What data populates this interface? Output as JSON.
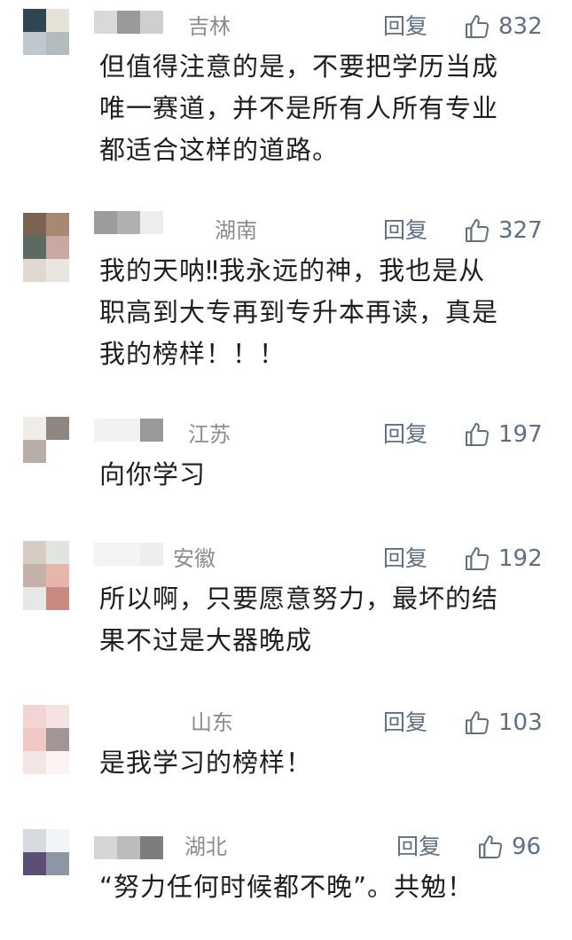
{
  "reply_label": "回复",
  "comments": [
    {
      "region": "吉林",
      "likes": "832",
      "text": "但值得注意的是，不要把学历当成\n唯一赛道，并不是所有人所有专业\n都适合这样的道路。",
      "avatar_colors": [
        "#2f4552",
        "#e6e3d6",
        "#bfc8cc",
        "#b4bbbe"
      ],
      "name_colors": [
        "#d9d9d9",
        "#9a9a9a",
        "#cfcfcf"
      ]
    },
    {
      "region": "湖南",
      "likes": "327",
      "text": "我的天呐‼我永远的神，我也是从\n职高到大专再到专升本再读，真是\n我的榜样！！！",
      "avatar_colors": [
        "#7a6350",
        "#a88870",
        "#5c6b62",
        "#c8a8a0",
        "#e0d9cf",
        "#e8e6df"
      ],
      "name_colors": [
        "#9c9c9c",
        "#b0b0b0",
        "#ededed"
      ]
    },
    {
      "region": "江苏",
      "likes": "197",
      "text": "向你学习",
      "avatar_colors": [
        "#f0ece8",
        "#8f8682",
        "#b9aea6",
        "#ffffff"
      ],
      "name_colors": [
        "#f2f2f2",
        "#f2f2f2",
        "#999999"
      ]
    },
    {
      "region": "安徽",
      "likes": "192",
      "text": "所以啊，只要愿意努力，最坏的结\n果不过是大器晚成",
      "avatar_colors": [
        "#d7ccc4",
        "#dfe6e0",
        "#c4b1a8",
        "#e6b6ad",
        "#e7e7e7",
        "#c98b80"
      ],
      "name_colors": [
        "#f4f4f4",
        "#f4f4f4",
        "#eeeeee"
      ]
    },
    {
      "region": "山东",
      "likes": "103",
      "text": "是我学习的榜样！",
      "avatar_colors": [
        "#f2d5d2",
        "#f5e3e1",
        "#f0c9c4",
        "#a19595"
      ],
      "name_colors": [
        "#ffffff",
        "#ffffff",
        "#ffffff"
      ]
    },
    {
      "region": "湖北",
      "likes": "96",
      "text": "“努力任何时候都不晚”。共勉！",
      "avatar_colors": [
        "#d7dade",
        "#f2f4f6",
        "#5b4f78",
        "#8e96a5"
      ],
      "name_colors": [
        "#d6d6d6",
        "#bcbcbc",
        "#7d7d7d"
      ]
    }
  ]
}
